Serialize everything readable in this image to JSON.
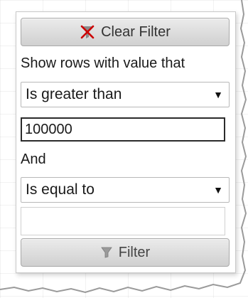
{
  "filter_popup": {
    "clear_button": {
      "label": "Clear Filter",
      "icon": "clear-filter-icon",
      "icon_color": "#cc0000"
    },
    "instruction": "Show rows with value that",
    "condition1": {
      "selected": "Is greater than"
    },
    "value1": "100000",
    "conjunction": "And",
    "condition2": {
      "selected": "Is equal to"
    },
    "value2": "",
    "filter_button": {
      "label": "Filter",
      "icon": "funnel-icon"
    }
  }
}
